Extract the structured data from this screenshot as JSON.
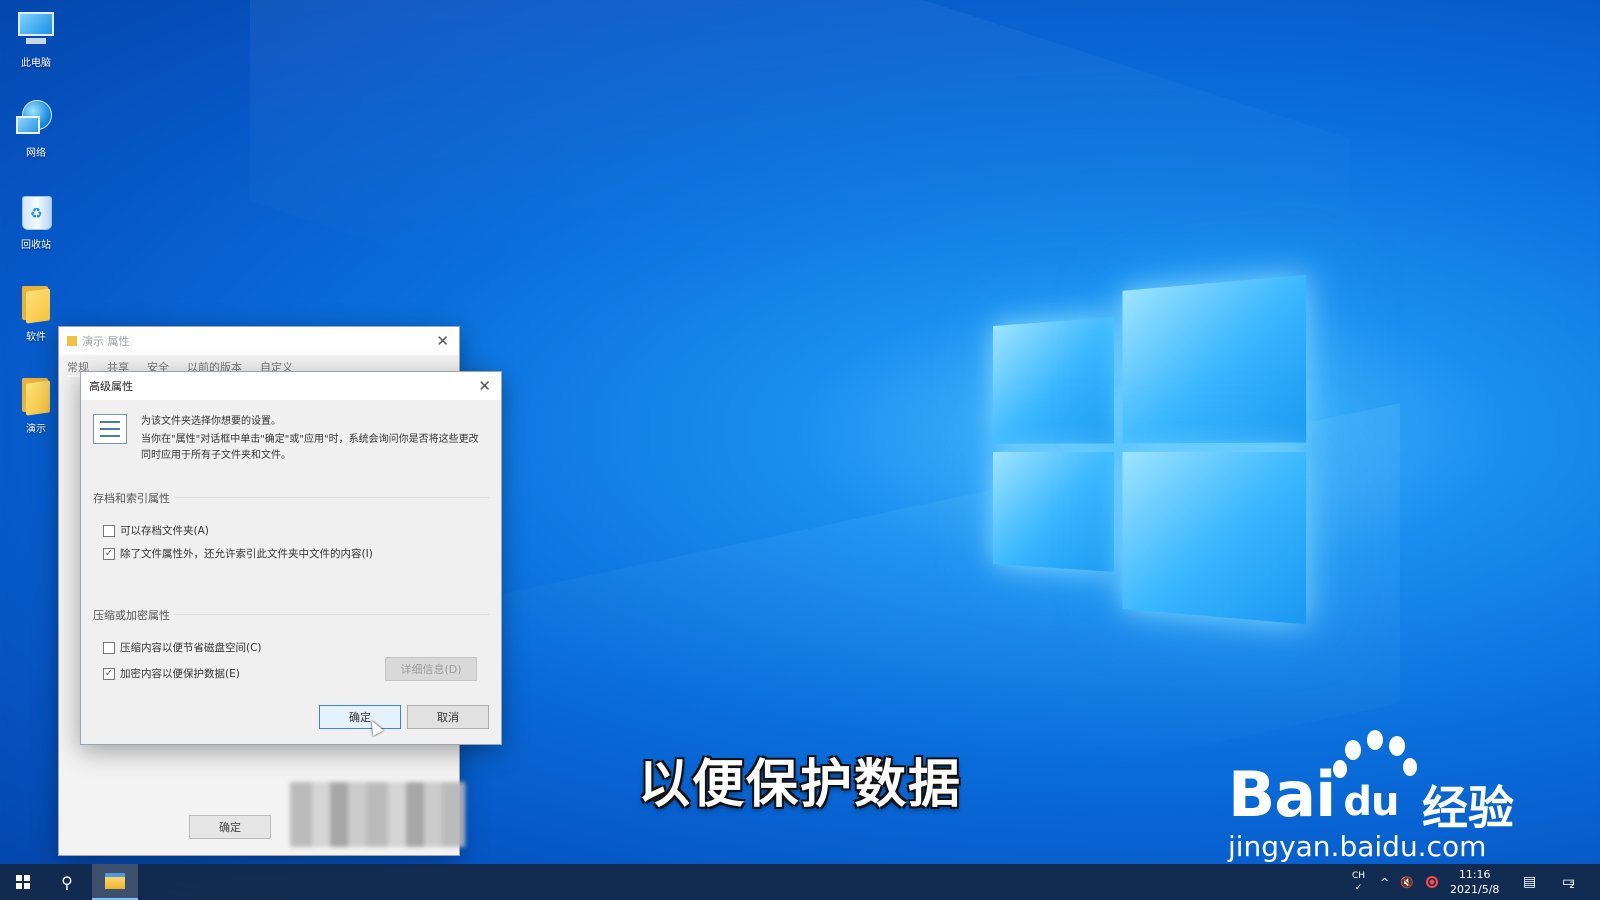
{
  "desktop": {
    "icons": [
      {
        "label": "此电脑",
        "icon": "this-pc-icon"
      },
      {
        "label": "网络",
        "icon": "network-icon"
      },
      {
        "label": "回收站",
        "icon": "recycle-bin-icon"
      },
      {
        "label": "软件",
        "icon": "folder-icon"
      },
      {
        "label": "演示",
        "icon": "folder-icon"
      }
    ]
  },
  "back_window": {
    "title": "演示 属性",
    "tabs": [
      "常规",
      "共享",
      "安全",
      "以前的版本",
      "自定义"
    ],
    "ok_label": "确定"
  },
  "advanced_dialog": {
    "title": "高级属性",
    "info_line1": "为该文件夹选择你想要的设置。",
    "info_line2": "当你在\"属性\"对话框中单击\"确定\"或\"应用\"时，系统会询问你是否将这些更改同时应用于所有子文件夹和文件。",
    "archive_group": {
      "title": "存档和索引属性",
      "options": [
        {
          "label": "可以存档文件夹(A)",
          "checked": false
        },
        {
          "label": "除了文件属性外，还允许索引此文件夹中文件的内容(I)",
          "checked": true
        }
      ]
    },
    "compress_group": {
      "title": "压缩或加密属性",
      "options": [
        {
          "label": "压缩内容以便节省磁盘空间(C)",
          "checked": false
        },
        {
          "label": "加密内容以便保护数据(E)",
          "checked": true
        }
      ],
      "details_label": "详细信息(D)"
    },
    "ok_label": "确定",
    "cancel_label": "取消"
  },
  "subtitle": "以便保护数据",
  "watermark": {
    "brand": "Bai",
    "brand_du": "du",
    "cn": "经验",
    "url": "jingyan.baidu.com"
  },
  "taskbar": {
    "ime_line1": "CH",
    "ime_line2": "✓",
    "time": "11:16",
    "date": "2021/5/8",
    "notification_count": "2"
  },
  "colors": {
    "desktop_blue": "#0a6fdc",
    "logo_glow": "#38b6ff",
    "dialog_bg": "#f0f0f0",
    "taskbar": "#142846"
  }
}
